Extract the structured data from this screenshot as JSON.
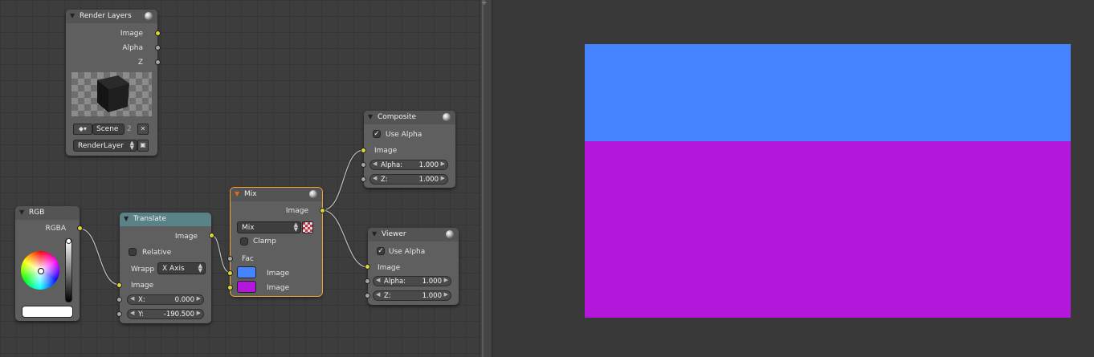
{
  "colors": {
    "backdrop_top": "#4583ff",
    "backdrop_bottom": "#b317dc",
    "mix_swatch_1": "#4583ff",
    "mix_swatch_2": "#b317dc",
    "socket_color": "#d8d835",
    "socket_value": "#a5a5a5",
    "selection": "#f4a13a"
  },
  "render_layers": {
    "title": "Render Layers",
    "outputs": [
      "Image",
      "Alpha",
      "Z"
    ],
    "scene": "Scene",
    "scene_users": "2",
    "layer": "RenderLayer"
  },
  "rgb": {
    "title": "RGB",
    "output": "RGBA",
    "color": "#ffffff"
  },
  "translate": {
    "title": "Translate",
    "output": "Image",
    "relative_label": "Relative",
    "relative_checked": false,
    "wrap_label": "Wrapp",
    "wrap_value": "X Axis",
    "input": "Image",
    "x_label": "X:",
    "x_value": "0.000",
    "y_label": "Y:",
    "y_value": "-190.500"
  },
  "mix": {
    "title": "Mix",
    "output": "Image",
    "blend_mode": "Mix",
    "clamp_label": "Clamp",
    "clamp_checked": false,
    "fac_label": "Fac",
    "image1_label": "Image",
    "image2_label": "Image"
  },
  "composite": {
    "title": "Composite",
    "use_alpha_label": "Use Alpha",
    "use_alpha_checked": true,
    "input": "Image",
    "alpha_label": "Alpha:",
    "alpha_value": "1.000",
    "z_label": "Z:",
    "z_value": "1.000"
  },
  "viewer": {
    "title": "Viewer",
    "use_alpha_label": "Use Alpha",
    "use_alpha_checked": true,
    "input": "Image",
    "alpha_label": "Alpha:",
    "alpha_value": "1.000",
    "z_label": "Z:",
    "z_value": "1.000"
  },
  "icons": {
    "node_collapse": "triangle-down-icon",
    "node_preview": "sphere-icon",
    "checkmark": "checkmark-icon",
    "scene_browse": "scene-browse-icon",
    "scene_unlink": "x-icon",
    "layer_render": "render-icon",
    "mix_alpha": "checker-alpha-icon",
    "area_corner": "plus-icon"
  }
}
